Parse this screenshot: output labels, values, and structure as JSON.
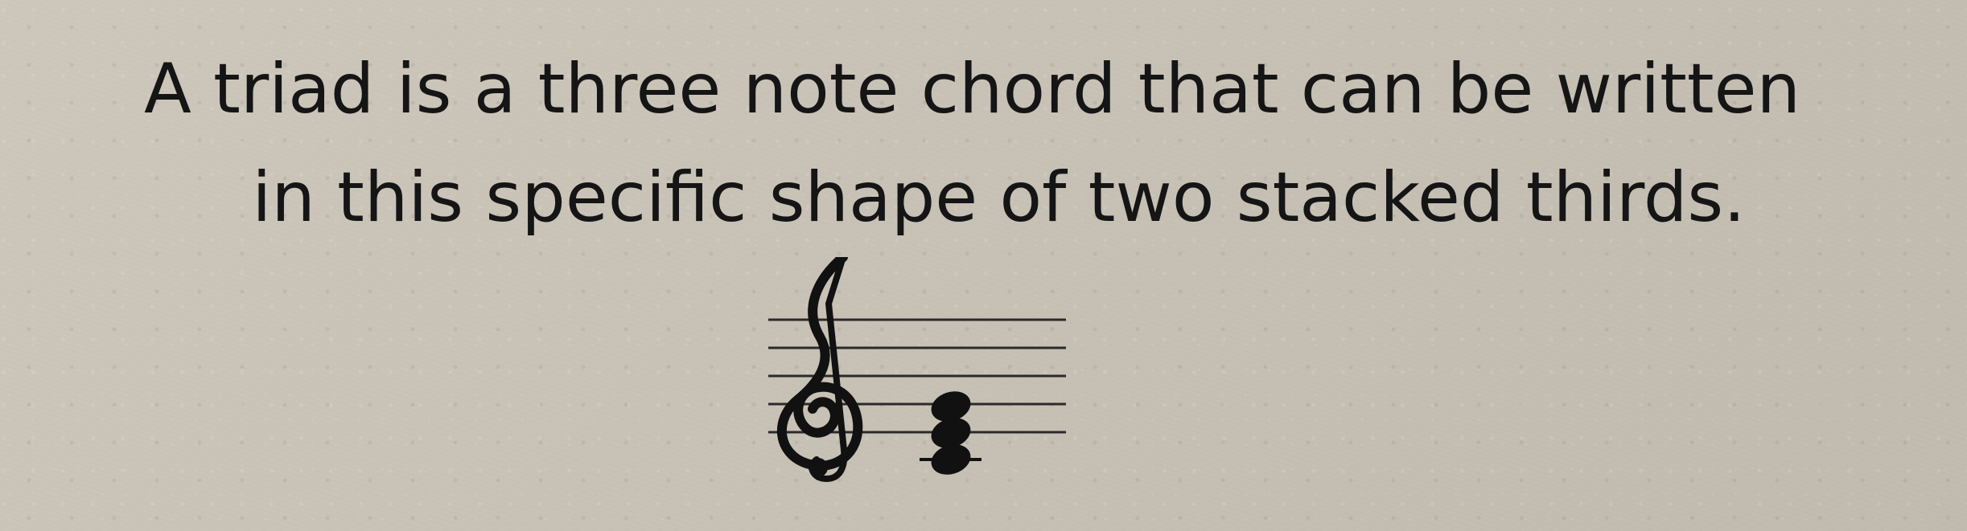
{
  "caption": {
    "line1": "A triad is a three note chord that can be written",
    "line2": "in this specific shape of two stacked thirds."
  },
  "notation": {
    "clef_icon": "treble-clef-icon",
    "chord_notes_icon": "whole-note-icon",
    "chord_note_count": 3,
    "ink_color": "#111111",
    "paper_color": "#c9c2b6"
  }
}
